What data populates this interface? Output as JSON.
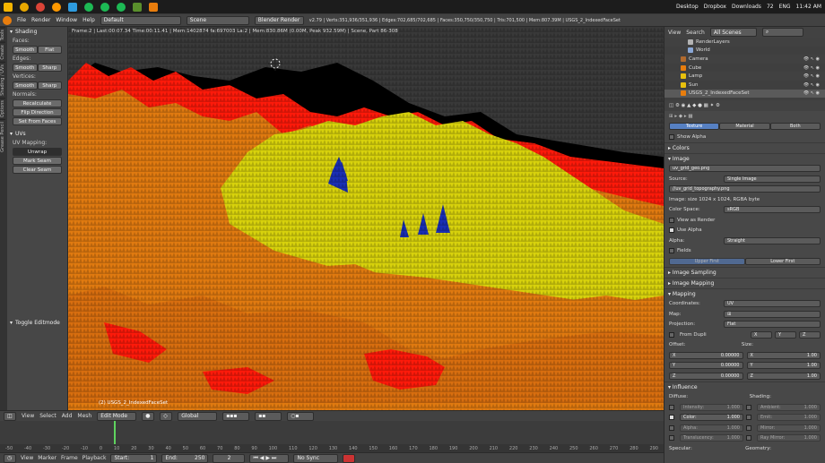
{
  "taskbar": {
    "dropbox": "Desktop",
    "dropbox2": "Dropbox",
    "downloads": "Downloads",
    "battery": "72",
    "lang": "ENG",
    "time": "11:42 AM"
  },
  "header": {
    "menus": [
      "File",
      "Render",
      "Window",
      "Help"
    ],
    "layout": "Default",
    "scene": "Scene",
    "engine": "Blender Render",
    "stats": "v2.79 | Verts:351,936/351,936 | Edges:702,685/702,685 | Faces:350,750/350,750 | Tris:701,500 | Mem:807.39M | USGS_2_IndexedFaceSet"
  },
  "left_tabs": [
    "Tools",
    "Create",
    "Shading / UVs",
    "Options",
    "Grease Pencil"
  ],
  "tool_panel": {
    "shading_title": "Shading",
    "faces_label": "Faces:",
    "edges_label": "Edges:",
    "vertices_label": "Vertices:",
    "smooth": "Smooth",
    "flat": "Flat",
    "sharp": "Sharp",
    "normals_label": "Normals:",
    "recalculate": "Recalculate",
    "flip_direction": "Flip Direction",
    "set_from_faces": "Set From Faces",
    "uvs_title": "UVs",
    "uv_mapping_label": "UV Mapping:",
    "unwrap": "Unwrap",
    "mark_seam": "Mark Seam",
    "clear_seam": "Clear Seam",
    "toggle_editmode": "Toggle Editmode"
  },
  "viewport": {
    "status": "Frame:2 | Last:00:07.34 Time:00:11.41 | Mem:1402874 fa:697003 La:2 | Mem:830.86M (0.00M, Peak 932.59M) | Scene, Part 86-308",
    "object_label": "(2) USGS_2_IndexedFaceSet"
  },
  "viewport_header": {
    "menus": [
      "View",
      "Select",
      "Add",
      "Mesh"
    ],
    "mode": "Edit Mode",
    "orientation": "Global"
  },
  "timeline": {
    "ruler": [
      "-50",
      "-40",
      "-30",
      "-20",
      "-10",
      "0",
      "10",
      "20",
      "30",
      "40",
      "50",
      "60",
      "70",
      "80",
      "90",
      "100",
      "110",
      "120",
      "130",
      "140",
      "150",
      "160",
      "170",
      "180",
      "190",
      "200",
      "210",
      "220",
      "230",
      "240",
      "250",
      "260",
      "270",
      "280",
      "290"
    ],
    "menus": [
      "View",
      "Marker",
      "Frame",
      "Playback"
    ],
    "start_label": "Start:",
    "start_value": "1",
    "end_label": "End:",
    "end_value": "250",
    "current": "2",
    "sync": "No Sync"
  },
  "outliner": {
    "view": "View",
    "search": "Search",
    "scenes": "All Scenes",
    "items": [
      "RenderLayers",
      "World",
      "Camera",
      "Cube",
      "Lamp",
      "Sun",
      "USGS_2_IndexedFaceSet"
    ]
  },
  "properties": {
    "tabs": [
      "Texture",
      "Material",
      "Both"
    ],
    "show_alpha": "Show Alpha",
    "colors": "Colors",
    "image": "Image",
    "image_name": "uv_grid_geo.png",
    "source_label": "Source:",
    "source_value": "Single Image",
    "file_path": "//uv_grid_topography.png",
    "image_info": "Image: size 1024 x 1024, RGBA byte",
    "color_space_label": "Color Space:",
    "color_space_value": "sRGB",
    "view_as_render": "View as Render",
    "use_alpha": "Use Alpha",
    "alpha_label": "Alpha:",
    "alpha_value": "Straight",
    "fields": "Fields",
    "upper_first": "Upper First",
    "lower_first": "Lower First",
    "image_sampling": "Image Sampling",
    "image_mapping": "Image Mapping",
    "mapping": "Mapping",
    "coordinates_label": "Coordinates:",
    "coordinates_value": "UV",
    "map_label": "Map:",
    "projection_label": "Projection:",
    "projection_value": "Flat",
    "from_dupli": "From Dupli",
    "axes": [
      "X",
      "Y",
      "Z"
    ],
    "offset_label": "Offset:",
    "size_label": "Size:",
    "offset_values": [
      "0.00000",
      "0.00000",
      "0.00000"
    ],
    "size_values": [
      "1.00",
      "1.00",
      "1.00"
    ],
    "influence": "Influence",
    "diffuse_label": "Diffuse:",
    "shading_label": "Shading:",
    "diffuse": [
      "Intensity:",
      "Color:",
      "Alpha:",
      "Translucency:"
    ],
    "diffuse_vals": [
      "1.000",
      "1.000",
      "1.000",
      "1.000"
    ],
    "shading": [
      "Ambient:",
      "Emit:",
      "Mirror:",
      "Ray Mirror:"
    ],
    "shading_vals": [
      "1.000",
      "1.000",
      "1.000",
      "1.000"
    ],
    "specular_label": "Specular:",
    "geometry_label": "Geometry:"
  },
  "colors": {
    "terrain_low": "#ff1a0a",
    "terrain_mid": "#e07a10",
    "terrain_high": "#d8d20c",
    "terrain_peak": "#1a2fb5",
    "selected_tab": "#5680c2"
  }
}
